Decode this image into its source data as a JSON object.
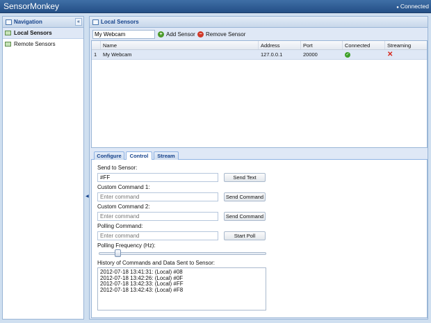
{
  "app": {
    "title": "SensorMonkey",
    "status": "Connected"
  },
  "nav": {
    "title": "Navigation",
    "collapse_glyph": "«",
    "items": [
      {
        "label": "Local Sensors",
        "icon": "sensor-icon",
        "active": true
      },
      {
        "label": "Remote Sensors",
        "icon": "sensor-icon",
        "active": false
      }
    ]
  },
  "main": {
    "title": "Local Sensors",
    "toolbar": {
      "sensor_value": "My Webcam",
      "add_label": "Add Sensor",
      "remove_label": "Remove Sensor"
    },
    "grid": {
      "columns": [
        "Name",
        "Address",
        "Port",
        "Connected",
        "Streaming"
      ],
      "rows": [
        {
          "index": "1",
          "name": "My Webcam",
          "address": "127.0.0.1",
          "port": "20000",
          "connected": true,
          "streaming": false
        }
      ]
    },
    "tabs": [
      {
        "label": "Configure",
        "active": false
      },
      {
        "label": "Control",
        "active": true
      },
      {
        "label": "Stream",
        "active": false
      }
    ],
    "control": {
      "send_label": "Send to Sensor:",
      "send_value": "#FF",
      "send_button": "Send Text",
      "custom1_label": "Custom Command 1:",
      "custom1_placeholder": "Enter command",
      "custom1_button": "Send Command",
      "custom2_label": "Custom Command 2:",
      "custom2_placeholder": "Enter command",
      "custom2_button": "Send Command",
      "polling_label": "Polling Command:",
      "polling_placeholder": "Enter command",
      "polling_button": "Start Poll",
      "frequency_label": "Polling Frequency (Hz):",
      "frequency_level": 0.1,
      "history_label": "History of Commands and Data Sent to Sensor:",
      "history": [
        "2012-07-18 13:41:31: (Local) #08",
        "2012-07-18 13:42:26: (Local) #0F",
        "2012-07-18 13:42:33: (Local) #FF",
        "2012-07-18 13:42:43: (Local) #F8"
      ]
    }
  }
}
